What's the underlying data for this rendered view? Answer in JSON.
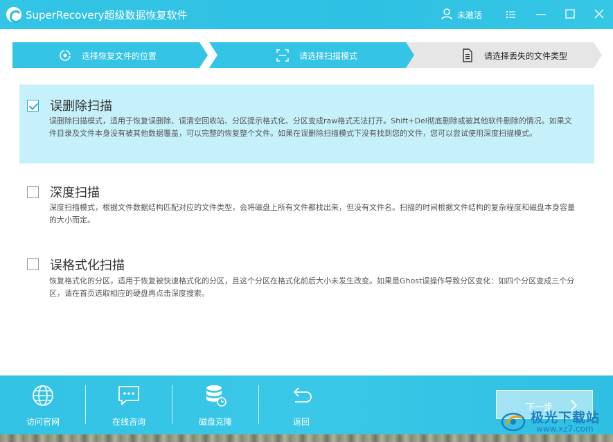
{
  "app": {
    "title": "SuperRecovery超级数据恢复软件",
    "user_label": "未激活",
    "icons": [
      "logo-icon",
      "user-icon",
      "menu-icon",
      "minimize-icon",
      "maximize-icon",
      "close-icon"
    ]
  },
  "steps": [
    {
      "label": "选择恢复文件的位置",
      "state": "done",
      "icon": "location-target-icon"
    },
    {
      "label": "请选择扫描模式",
      "state": "done",
      "icon": "scan-frame-icon"
    },
    {
      "label": "请选择丢失的文件类型",
      "state": "current",
      "icon": "document-icon"
    }
  ],
  "options": [
    {
      "title": "误删除扫描",
      "checked": true,
      "description": "误删除扫描模式，适用于恢复误删除、误清空回收站、分区提示格式化、分区变成raw格式无法打开。Shift+Del彻底删除或被其他软件删除的情况。如果文件目录及文件本身没有被其他数据覆盖，可以完整的恢复整个文件。如果在误删除扫描模式下没有找到您的文件，您可以尝试使用深度扫描模式。"
    },
    {
      "title": "深度扫描",
      "checked": false,
      "description": "深度扫描模式，根据文件数据结构匹配对应的文件类型，会将磁盘上所有文件都找出来，但没有文件名。扫描的时间根据文件结构的复杂程度和磁盘本身容量的大小而定。"
    },
    {
      "title": "误格式化扫描",
      "checked": false,
      "description": "恢复格式化的分区，适用于恢复被快速格式化的分区，且这个分区在格式化前后大小未发生改变。如果是Ghost误操作导致分区变化：如四个分区变成三个分区，请在首页选取相应的硬盘再点击深度搜索。"
    }
  ],
  "toolbar": {
    "items": [
      {
        "label": "访问官网",
        "icon": "globe-icon"
      },
      {
        "label": "在线咨询",
        "icon": "chat-icon"
      },
      {
        "label": "磁盘克隆",
        "icon": "database-icon"
      },
      {
        "label": "返回",
        "icon": "return-arrow-icon"
      }
    ],
    "next_label": "下一步"
  },
  "watermark": {
    "text": "极光下载站",
    "url": "www.xz7.com"
  },
  "colors": {
    "accent": "#33c4e6",
    "selected_bg": "#c6f1fb",
    "step_inactive": "#e6e6e6"
  }
}
